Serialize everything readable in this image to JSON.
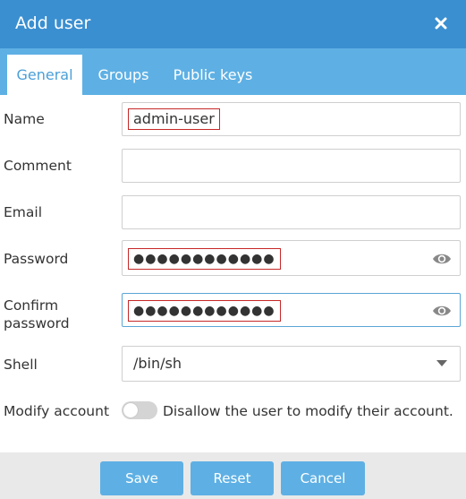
{
  "dialog": {
    "title": "Add user",
    "close_icon": "close-icon"
  },
  "tabs": [
    {
      "label": "General",
      "active": true
    },
    {
      "label": "Groups",
      "active": false
    },
    {
      "label": "Public keys",
      "active": false
    }
  ],
  "form": {
    "name": {
      "label": "Name",
      "value": "admin-user"
    },
    "comment": {
      "label": "Comment",
      "value": ""
    },
    "email": {
      "label": "Email",
      "value": ""
    },
    "password": {
      "label": "Password",
      "value": "●●●●●●●●●●●●",
      "icon": "eye-icon"
    },
    "confirm_password": {
      "label_line1": "Confirm",
      "label_line2": "password",
      "value": "●●●●●●●●●●●●",
      "icon": "eye-icon"
    },
    "shell": {
      "label": "Shell",
      "value": "/bin/sh",
      "icon": "chevron-down-icon"
    },
    "modify_account": {
      "label": "Modify account",
      "toggle_text": "Disallow the user to modify their account.",
      "enabled": false
    }
  },
  "buttons": {
    "save": "Save",
    "reset": "Reset",
    "cancel": "Cancel"
  },
  "colors": {
    "titlebar": "#3a8fd0",
    "tabbar": "#5eb0e4",
    "button": "#5eb0e4",
    "footer": "#e9e9e9",
    "highlight_border": "#c62828"
  }
}
